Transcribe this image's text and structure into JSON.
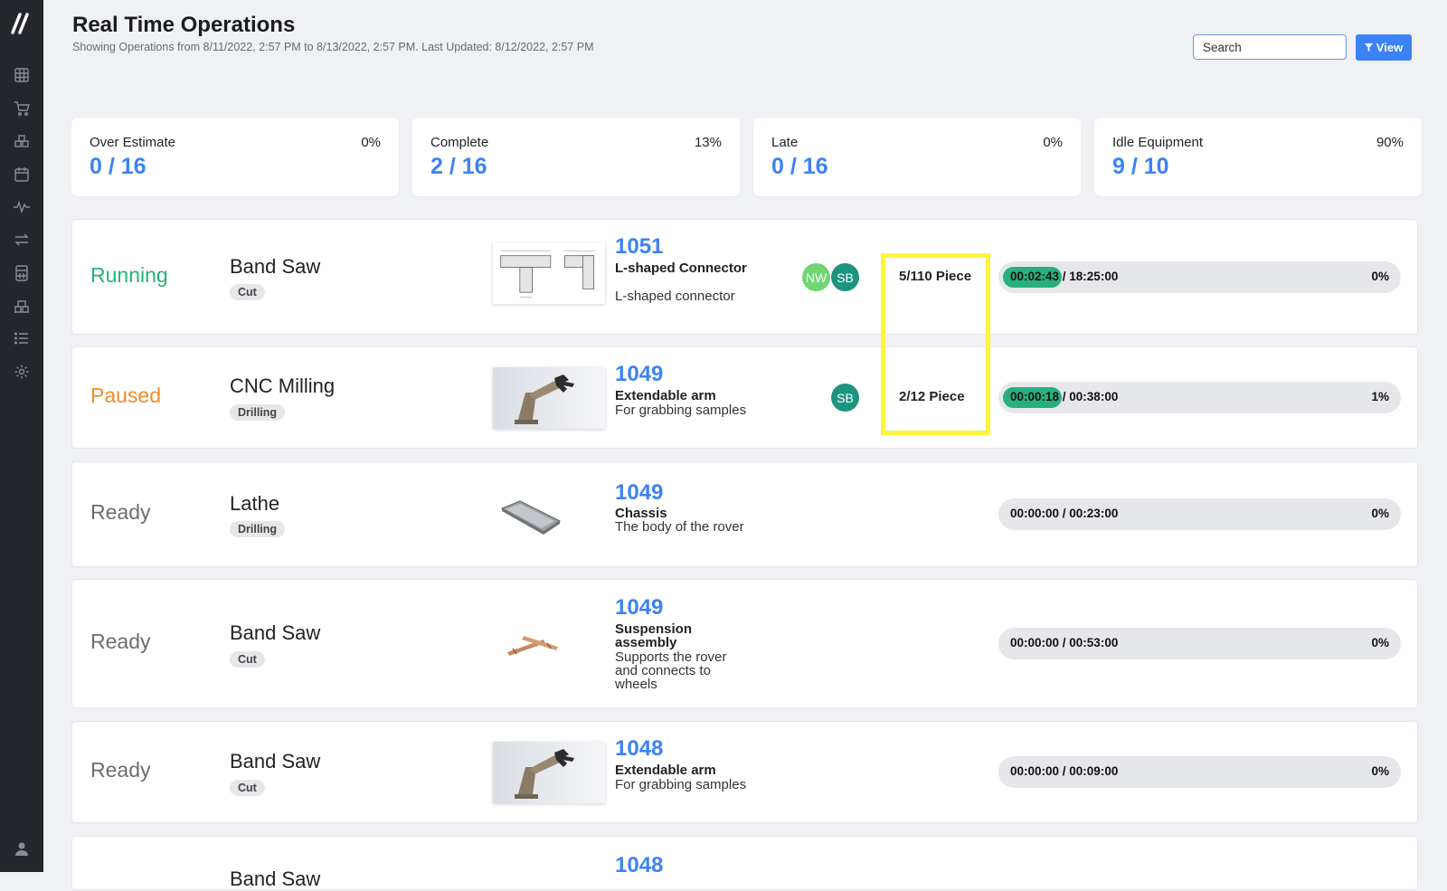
{
  "header": {
    "title": "Real Time Operations",
    "subtitle": "Showing Operations from 8/11/2022, 2:57 PM to 8/13/2022, 2:57 PM. Last Updated: 8/12/2022, 2:57 PM",
    "search_placeholder": "Search",
    "view_label": "View"
  },
  "sidebar": {
    "icons": [
      "grid-icon",
      "cart-icon",
      "boxes-icon",
      "calendar-icon",
      "activity-icon",
      "transfer-icon",
      "calculator-icon",
      "inventory-icon",
      "list-icon",
      "settings-icon",
      "user-icon"
    ]
  },
  "colors": {
    "accent": "#3b82f6",
    "running": "#22b573",
    "paused": "#f28c28",
    "ready": "#6b6d73",
    "progress": "#27b07d",
    "highlight": "#fdf43b"
  },
  "stats": [
    {
      "label": "Over Estimate",
      "value": "0 / 16",
      "pct": "0%"
    },
    {
      "label": "Complete",
      "value": "2 / 16",
      "pct": "13%"
    },
    {
      "label": "Late",
      "value": "0 / 16",
      "pct": "0%"
    },
    {
      "label": "Idle Equipment",
      "value": "9 / 10",
      "pct": "90%"
    }
  ],
  "operations": [
    {
      "status": "Running",
      "equipment": "Band Saw",
      "operation": "Cut",
      "part_number": "1051",
      "part_name": "L-shaped Connector",
      "part_description": "L-shaped connector",
      "assignees": [
        "NW",
        "SB"
      ],
      "quantity": "5/110 Piece",
      "time": "00:02:43 / 18:25:00",
      "percent": "0%",
      "progress_fraction": 0.15
    },
    {
      "status": "Paused",
      "equipment": "CNC Milling",
      "operation": "Drilling",
      "part_number": "1049",
      "part_name": "Extendable arm",
      "part_description": "For grabbing samples",
      "assignees": [
        "SB"
      ],
      "quantity": "2/12 Piece",
      "time": "00:00:18 / 00:38:00",
      "percent": "1%",
      "progress_fraction": 0.15
    },
    {
      "status": "Ready",
      "equipment": "Lathe",
      "operation": "Drilling",
      "part_number": "1049",
      "part_name": "Chassis",
      "part_description": "The body of the rover",
      "assignees": [],
      "quantity": "",
      "time": "00:00:00 / 00:23:00",
      "percent": "0%",
      "progress_fraction": 0
    },
    {
      "status": "Ready",
      "equipment": "Band Saw",
      "operation": "Cut",
      "part_number": "1049",
      "part_name": "Suspension assembly",
      "part_description": "Supports the rover and connects to wheels",
      "assignees": [],
      "quantity": "",
      "time": "00:00:00 / 00:53:00",
      "percent": "0%",
      "progress_fraction": 0
    },
    {
      "status": "Ready",
      "equipment": "Band Saw",
      "operation": "Cut",
      "part_number": "1048",
      "part_name": "Extendable arm",
      "part_description": "For grabbing samples",
      "assignees": [],
      "quantity": "",
      "time": "00:00:00 / 00:09:00",
      "percent": "0%",
      "progress_fraction": 0
    },
    {
      "status": "",
      "equipment": "Band Saw",
      "operation": "",
      "part_number": "1048",
      "part_name": "",
      "part_description": "",
      "assignees": [],
      "quantity": "",
      "time": "",
      "percent": "",
      "progress_fraction": 0
    }
  ]
}
